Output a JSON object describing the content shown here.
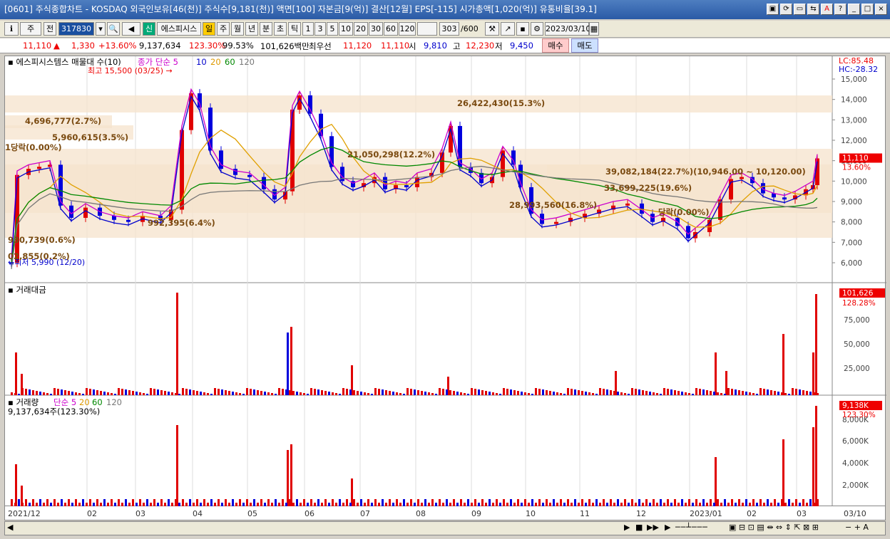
{
  "window": {
    "title": "[0601] 주식종합차트 - KOSDAQ 외국인보유[46(천)] 주식수[9,181(천)] 액면[100] 자본금[9(억)] 결산[12월] EPS[-115] 시가총액[1,020(억)] 유통비율[39.1]",
    "buttons": [
      "▣",
      "⟳",
      "▭",
      "⇆",
      "A",
      "?",
      "_",
      "□",
      "×"
    ]
  },
  "toolbar": {
    "type": "주",
    "prev": "전",
    "code": "317830",
    "stock_name": "에스피시스",
    "periods": [
      "일",
      "주",
      "월",
      "년",
      "분",
      "초",
      "틱"
    ],
    "intervals": [
      "1",
      "3",
      "5",
      "10",
      "20",
      "30",
      "60",
      "120"
    ],
    "count": "303",
    "count_max": "/600",
    "date": "2023/03/10"
  },
  "quote": {
    "price": "11,110",
    "arrow": "▲",
    "change": "1,330",
    "change_pct": "+13.60%",
    "volume": "9,137,634",
    "vol_ratio": "123.30%",
    "vol_pct": "99.53%",
    "amount": "101,626백만",
    "best_label": "최우선",
    "ask": "11,120",
    "bid": "11,110",
    "open_label": "시",
    "open": "9,810",
    "high_label": "고",
    "high": "12,230",
    "low_label": "저",
    "low": "9,450",
    "buy": "매수",
    "sell": "매도"
  },
  "price_panel": {
    "title": "에스피시스템스 매물대 수(10)",
    "ma_label": "종가 단순",
    "ma": [
      "5",
      "10",
      "20",
      "60",
      "120"
    ],
    "lc": "LC:85.48",
    "hc": "HC:-28.32",
    "last": "11,110",
    "last_pct": "13.60%",
    "high_note": "최고 15,500 (03/25)",
    "low_note": "최저 5,990 (12/20)",
    "yticks": [
      "15,000",
      "14,000",
      "13,000",
      "12,000",
      "11,000",
      "10,000",
      "9,000",
      "8,000",
      "7,000",
      "6,000"
    ],
    "annotations": [
      "26,422,430(15.3%)",
      "4,696,777(2.7%)",
      "5,960,615(3.5%)",
      "1당락(0.00%)",
      "21,050,298(12.2%)",
      "39,082,184(22.7%)(10,946.00 ~ 10,120.00)",
      "33,699,225(19.6%)",
      "28,993,560(16.8%)",
      "당락(0.00%)",
      "992,395(6.4%)",
      "930,739(0.6%)",
      "02,855(0.2%)"
    ]
  },
  "amount_panel": {
    "title": "거래대금",
    "last": "101,626",
    "last_pct": "128.28%",
    "yticks": [
      "75,000",
      "50,000",
      "25,000"
    ]
  },
  "volume_panel": {
    "title": "거래량",
    "ma_label": "단순",
    "ma": [
      "5",
      "20",
      "60",
      "120"
    ],
    "value": "9,137,634주(123.30%)",
    "last": "9,138K",
    "last_pct": "123.30%",
    "yticks": [
      "8,000K",
      "6,000K",
      "4,000K",
      "2,000K"
    ]
  },
  "xaxis": [
    "2021/12",
    "02",
    "03",
    "04",
    "05",
    "06",
    "07",
    "08",
    "09",
    "10",
    "11",
    "12",
    "2023/01",
    "02",
    "03",
    "03/10"
  ],
  "colors": {
    "up": "#e00000",
    "down": "#0000dd",
    "ma5": "#cc00cc",
    "ma10": "#0000cc",
    "ma20": "#e0a000",
    "ma60": "#008800",
    "ma120": "#777777",
    "band": "#f5e3cc"
  }
}
